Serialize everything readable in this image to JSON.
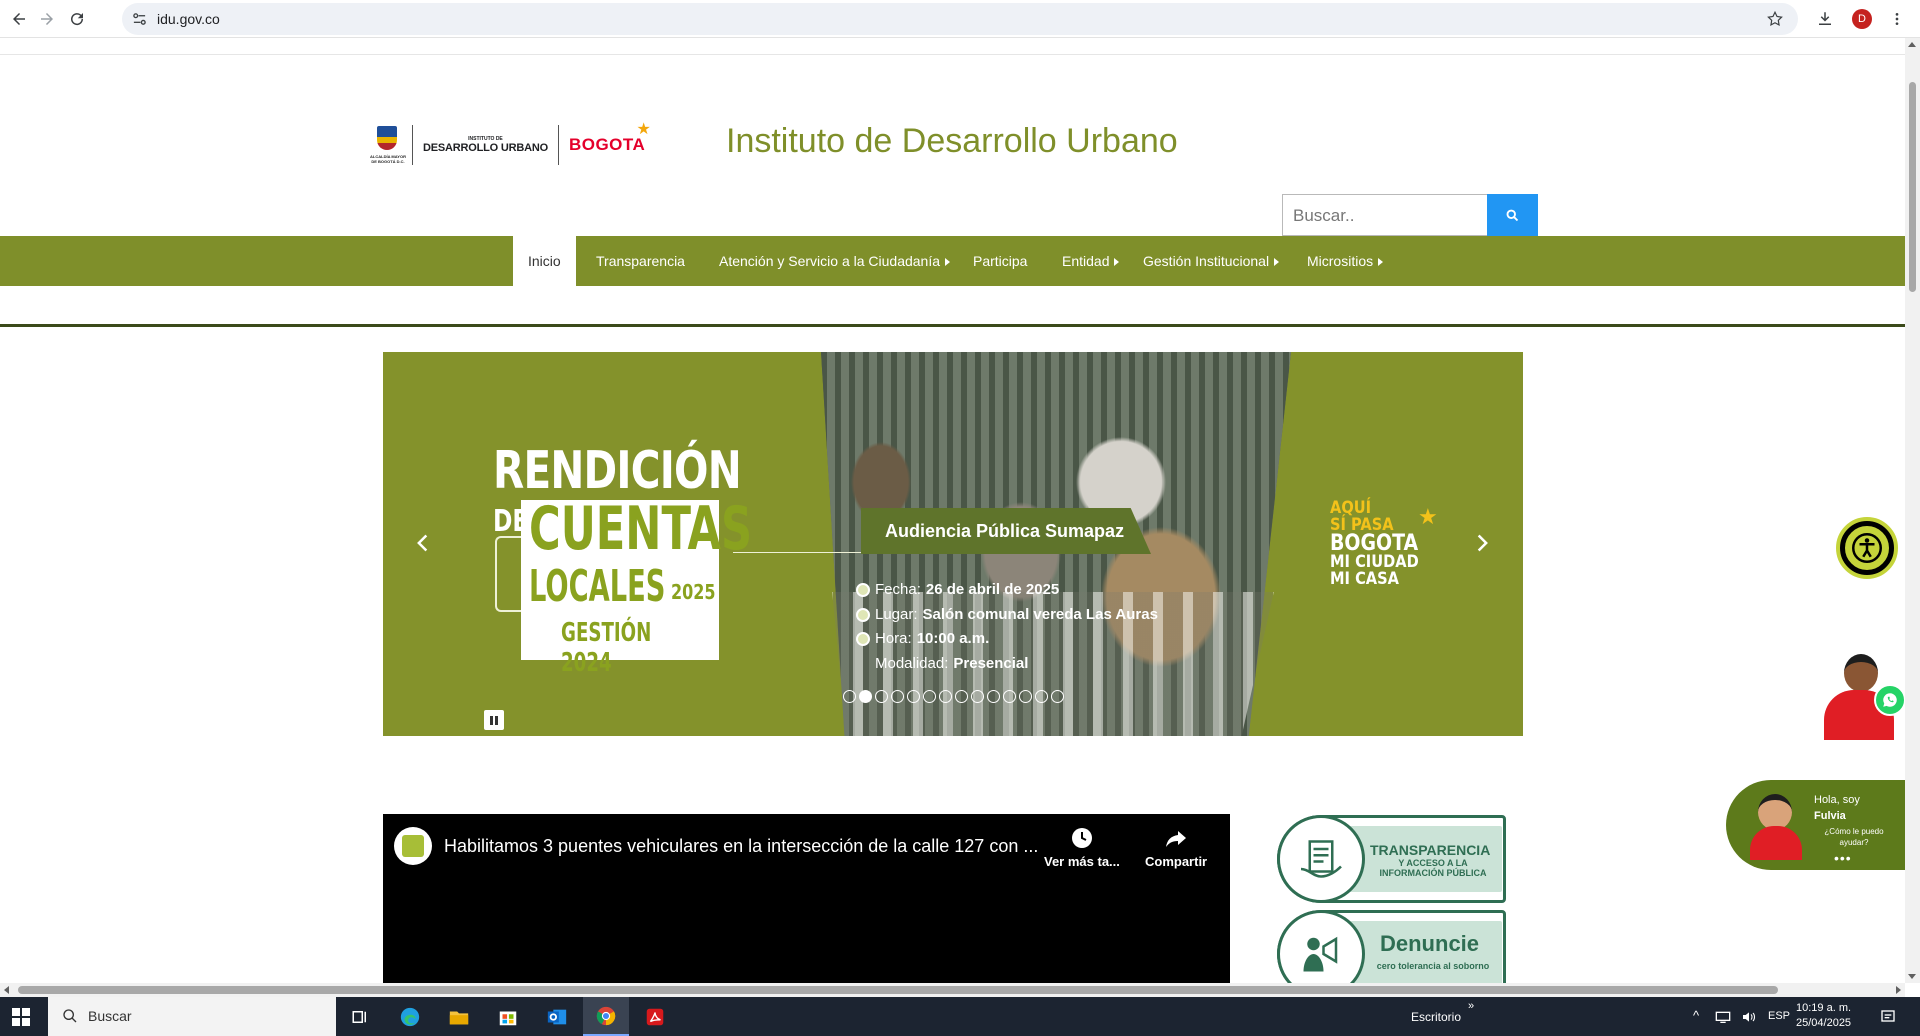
{
  "browser": {
    "url": "idu.gov.co",
    "profile_initial": "D"
  },
  "header": {
    "logo": {
      "seal_text": "ALCALDÍA MAYOR DE BOGOTÁ D.C.",
      "idu_small": "INSTITUTO DE",
      "idu_big": "DESARROLLO URBANO",
      "city": "BOGOTA"
    },
    "title": "Instituto de Desarrollo Urbano",
    "search_placeholder": "Buscar.."
  },
  "nav": {
    "items": [
      {
        "label": "Inicio",
        "active": true,
        "submenu": false
      },
      {
        "label": "Transparencia",
        "active": false,
        "submenu": false
      },
      {
        "label": "Atención y Servicio a la Ciudadanía",
        "active": false,
        "submenu": true
      },
      {
        "label": "Participa",
        "active": false,
        "submenu": false
      },
      {
        "label": "Entidad",
        "active": false,
        "submenu": true
      },
      {
        "label": "Gestión Institucional",
        "active": false,
        "submenu": true
      },
      {
        "label": "Micrositios",
        "active": false,
        "submenu": true
      }
    ]
  },
  "carousel": {
    "slide": {
      "title_line1": "RENDICIÓN",
      "title_de": "DE",
      "title_cuentas": "CUENTAS",
      "title_locales": "LOCALES",
      "title_year": "2025",
      "title_gestion": "GESTIÓN 2024",
      "audiencia": "Audiencia Pública Sumapaz",
      "details": [
        {
          "label": "Fecha:",
          "value": "26 de abril de 2025",
          "bullet": true
        },
        {
          "label": "Lugar:",
          "value": "Salón comunal vereda Las Auras",
          "bullet": true
        },
        {
          "label": "Hora:",
          "value": "10:00 a.m.",
          "bullet": true
        },
        {
          "label": "Modalidad:",
          "value": "Presencial",
          "bullet": false
        }
      ],
      "brand_line1": "AQUÍ",
      "brand_line2": "SÍ PASA",
      "brand_line3": "BOGOTA",
      "brand_line4": "MI CIUDAD",
      "brand_line5": "MI CASA"
    },
    "dot_count": 14,
    "active_dot": 1
  },
  "video": {
    "title": "Habilitamos 3 puentes vehiculares en la intersección de la calle 127 con ...",
    "watch_later": "Ver más ta...",
    "share": "Compartir"
  },
  "side_banners": {
    "transparencia": {
      "title": "TRANSPARENCIA",
      "subtitle": "Y ACCESO A LA INFORMACIÓN PÚBLICA"
    },
    "denuncie": {
      "title": "Denuncie",
      "subtitle": "cero tolerancia al soborno"
    }
  },
  "chat": {
    "greeting": "Hola, soy",
    "name": "Fulvia",
    "question": "¿Cómo le puedo ayudar?",
    "more": "•••"
  },
  "taskbar": {
    "search_label": "Buscar",
    "desktop_label": "Escritorio",
    "language": "ESP",
    "time": "10:19 a. m.",
    "date": "25/04/2025"
  },
  "colors": {
    "brand_green": "#7f8f2a",
    "search_blue": "#2196f3",
    "banner_green": "#2f6e53",
    "chat_green": "#5d7a1b",
    "accessibility_yellow": "#c5d43a"
  }
}
